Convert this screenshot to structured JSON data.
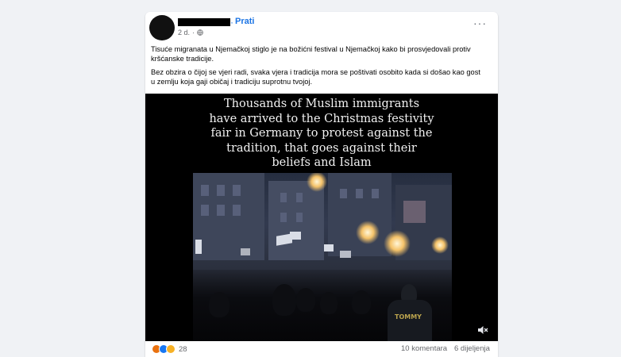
{
  "post": {
    "author_name": "",
    "separator": "·",
    "follow_label": "Prati",
    "time_ago": "2 d.",
    "time_separator": "·",
    "privacy_icon": "globe-icon",
    "more_icon": "more-options-icon",
    "more_glyph": "···",
    "paragraphs": [
      "Tisuće migranata u Njemačkoj stiglo je na božićni festival u Njemačkoj kako bi prosvjedovali protiv kršćanske tradicije.",
      "Bez obzira o čijoj se vjeri radi, svaka vjera i tradicija mora se poštivati osobito kada si došao kao gost u zemlju koja gaji običaj i tradiciju suprotnu tvojoj."
    ]
  },
  "video": {
    "caption_lines": [
      "Thousands of Muslim immigrants",
      "have arrived to the Christmas festivity",
      "fair in Germany to protest against the",
      "tradition, that goes against their",
      "beliefs and Islam"
    ],
    "jersey_text": "TOMMY",
    "mute_icon": "muted-speaker-icon"
  },
  "footer": {
    "reactions": [
      "angry-reaction-icon",
      "like-reaction-icon",
      "wow-reaction-icon"
    ],
    "reaction_count": "28",
    "comments": "10 komentara",
    "shares": "6 dijeljenja"
  },
  "colors": {
    "background": "#f0f2f5",
    "link_blue": "#1b74e4",
    "secondary_text": "#65676b",
    "angry": "#e9710f",
    "like": "#1877f2",
    "wow": "#f7b125"
  }
}
